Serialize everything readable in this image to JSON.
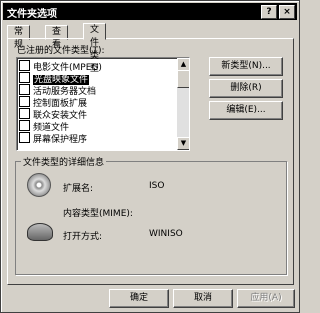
{
  "window": {
    "title": "文件夹选项",
    "help_glyph": "?",
    "close_glyph": "×"
  },
  "tabs": [
    {
      "label": "常规",
      "active": false
    },
    {
      "label": "查看",
      "active": false
    },
    {
      "label": "文件类型",
      "active": true
    }
  ],
  "registered_label": "已注册的文件类型(T):",
  "file_types": [
    {
      "label": "电影文件(MPEG)",
      "selected": false
    },
    {
      "label": "光盘映象文件",
      "selected": true
    },
    {
      "label": "活动服务器文档",
      "selected": false
    },
    {
      "label": "控制面板扩展",
      "selected": false
    },
    {
      "label": "联众安装文件",
      "selected": false
    },
    {
      "label": "频道文件",
      "selected": false
    },
    {
      "label": "屏幕保护程序",
      "selected": false
    }
  ],
  "buttons": {
    "new_type": "新类型(N)...",
    "remove": "删除(R)",
    "edit": "编辑(E)..."
  },
  "details": {
    "title": "文件类型的详细信息",
    "extension_label": "扩展名:",
    "extension_value": "ISO",
    "content_type_label": "内容类型(MIME):",
    "content_type_value": "",
    "opens_with_label": "打开方式:",
    "opens_with_value": "WINISO"
  },
  "footer": {
    "ok": "确定",
    "cancel": "取消",
    "apply": "应用(A)"
  }
}
